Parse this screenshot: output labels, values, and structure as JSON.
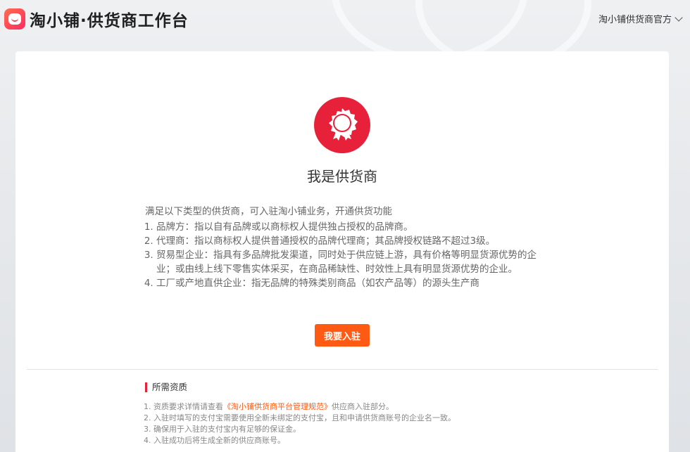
{
  "header": {
    "brand": "淘小铺·供货商工作台",
    "account_label": "淘小铺供货商官方"
  },
  "main": {
    "badge_icon": "award-badge-icon",
    "title": "我是供货商",
    "intro": "满足以下类型的供货商，可入驻淘小铺业务，开通供货功能",
    "types": [
      "品牌方：指以自有品牌或以商标权人提供独占授权的品牌商。",
      "代理商：指以商标权人提供普通授权的品牌代理商；其品牌授权链路不超过3级。",
      "贸易型企业：指具有多品牌批发渠道，同时处于供应链上游，具有价格等明显货源优势的企业；或由线上线下零售实体采买，在商品稀缺性、时效性上具有明显货源优势的企业。",
      "工厂或产地直供企业：指无品牌的特殊类别商品（如农产品等）的源头生产商"
    ],
    "cta_label": "我要入驻"
  },
  "qualifications": {
    "title": "所需资质",
    "item1_prefix": "资质要求详情请查看",
    "item1_link": "《淘小铺供货商平台管理规范》",
    "item1_suffix": "供应商入驻部分。",
    "item2": "入驻时填写的支付宝需要使用全新未绑定的支付宝，且和申请供货商账号的企业名一致。",
    "item3": "确保用于入驻的支付宝内有足够的保证金。",
    "item4": "入驻成功后将生成全新的供应商账号。"
  },
  "colors": {
    "brand_red": "#e8213a",
    "cta_orange": "#ff5a13"
  }
}
